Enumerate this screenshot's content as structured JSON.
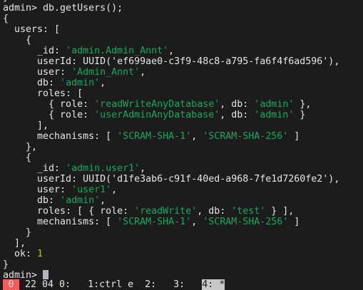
{
  "terminal": {
    "lines": [
      [
        {
          "t": "}",
          "c": ""
        }
      ],
      [
        {
          "t": "admin> db.getUsers();",
          "c": ""
        }
      ],
      [
        {
          "t": "{",
          "c": ""
        }
      ],
      [
        {
          "t": "  users: [",
          "c": ""
        }
      ],
      [
        {
          "t": "    {",
          "c": ""
        }
      ],
      [
        {
          "t": "      _id: ",
          "c": ""
        },
        {
          "t": "'admin.Admin_Annt'",
          "c": "s"
        },
        {
          "t": ",",
          "c": ""
        }
      ],
      [
        {
          "t": "      userId: UUID('ef699ae0-c3f9-48c8-a795-fa6f4f6ad596'),",
          "c": ""
        }
      ],
      [
        {
          "t": "      user: ",
          "c": ""
        },
        {
          "t": "'Admin_Annt'",
          "c": "s"
        },
        {
          "t": ",",
          "c": ""
        }
      ],
      [
        {
          "t": "      db: ",
          "c": ""
        },
        {
          "t": "'admin'",
          "c": "s"
        },
        {
          "t": ",",
          "c": ""
        }
      ],
      [
        {
          "t": "      roles: [",
          "c": ""
        }
      ],
      [
        {
          "t": "        { role: ",
          "c": ""
        },
        {
          "t": "'readWriteAnyDatabase'",
          "c": "s"
        },
        {
          "t": ", db: ",
          "c": ""
        },
        {
          "t": "'admin'",
          "c": "s"
        },
        {
          "t": " },",
          "c": ""
        }
      ],
      [
        {
          "t": "        { role: ",
          "c": ""
        },
        {
          "t": "'userAdminAnyDatabase'",
          "c": "s"
        },
        {
          "t": ", db: ",
          "c": ""
        },
        {
          "t": "'admin'",
          "c": "s"
        },
        {
          "t": " }",
          "c": ""
        }
      ],
      [
        {
          "t": "      ],",
          "c": ""
        }
      ],
      [
        {
          "t": "      mechanisms: [ ",
          "c": ""
        },
        {
          "t": "'SCRAM-SHA-1'",
          "c": "s"
        },
        {
          "t": ", ",
          "c": ""
        },
        {
          "t": "'SCRAM-SHA-256'",
          "c": "s"
        },
        {
          "t": " ]",
          "c": ""
        }
      ],
      [
        {
          "t": "    },",
          "c": ""
        }
      ],
      [
        {
          "t": "    {",
          "c": ""
        }
      ],
      [
        {
          "t": "      _id: ",
          "c": ""
        },
        {
          "t": "'admin.user1'",
          "c": "s"
        },
        {
          "t": ",",
          "c": ""
        }
      ],
      [
        {
          "t": "      userId: UUID('d1fe3ab6-c91f-40ed-a968-7fe1d7260fe2'),",
          "c": ""
        }
      ],
      [
        {
          "t": "      user: ",
          "c": ""
        },
        {
          "t": "'user1'",
          "c": "s"
        },
        {
          "t": ",",
          "c": ""
        }
      ],
      [
        {
          "t": "      db: ",
          "c": ""
        },
        {
          "t": "'admin'",
          "c": "s"
        },
        {
          "t": ",",
          "c": ""
        }
      ],
      [
        {
          "t": "      roles: [ { role: ",
          "c": ""
        },
        {
          "t": "'readWrite'",
          "c": "s"
        },
        {
          "t": ", db: ",
          "c": ""
        },
        {
          "t": "'test'",
          "c": "s"
        },
        {
          "t": " } ],",
          "c": ""
        }
      ],
      [
        {
          "t": "      mechanisms: [ ",
          "c": ""
        },
        {
          "t": "'SCRAM-SHA-1'",
          "c": "s"
        },
        {
          "t": ", ",
          "c": ""
        },
        {
          "t": "'SCRAM-SHA-256'",
          "c": "s"
        },
        {
          "t": " ]",
          "c": ""
        }
      ],
      [
        {
          "t": "    }",
          "c": ""
        }
      ],
      [
        {
          "t": "  ],",
          "c": ""
        }
      ],
      [
        {
          "t": "  ok: ",
          "c": ""
        },
        {
          "t": "1",
          "c": "n"
        }
      ],
      [
        {
          "t": "}",
          "c": ""
        }
      ]
    ],
    "prompt": "admin> "
  },
  "status_bar": {
    "session": "0",
    "windows_text": " 22 04 0:   1:ctrl e  2:   3:   ",
    "active_window": "4: *"
  },
  "colors": {
    "background": "#1c1c1c",
    "string": "#14a85a",
    "number": "#b6c41c",
    "status_red": "#f05d5d"
  }
}
